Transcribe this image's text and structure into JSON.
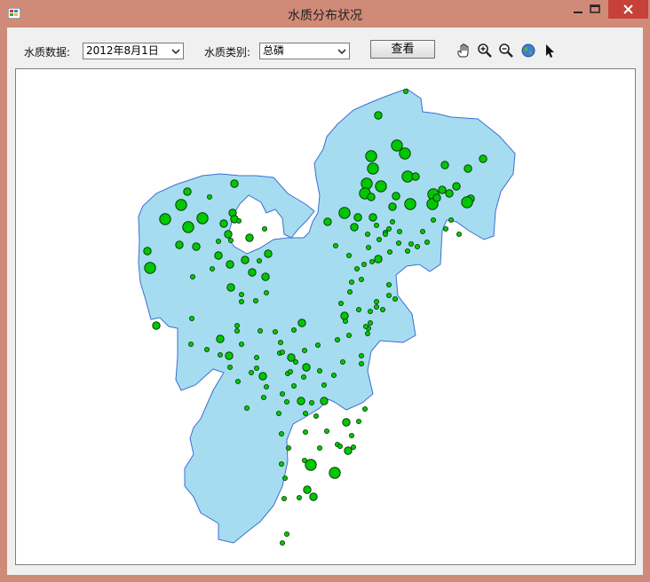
{
  "window": {
    "title": "水质分布状况"
  },
  "toolbar": {
    "date_label": "水质数据:",
    "date_value": "2012年8月1日",
    "type_label": "水质类别:",
    "type_value": "总磷",
    "view_button": "查看",
    "tools": [
      "pan-hand-icon",
      "zoom-in-icon",
      "zoom-out-icon",
      "full-extent-globe-icon",
      "select-arrow-icon"
    ]
  },
  "map": {
    "land_color": "#a6dcf0",
    "marker_color": "#00c800"
  }
}
